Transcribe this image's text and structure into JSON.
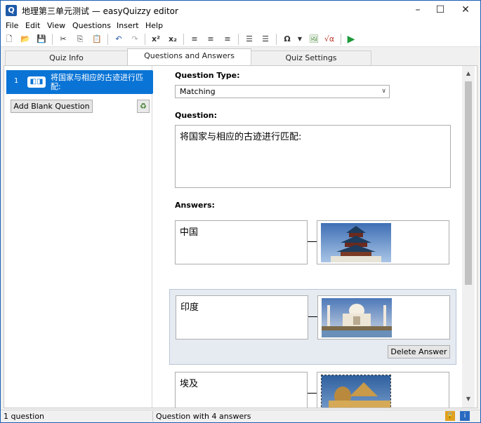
{
  "window": {
    "title": "地理第三单元测试 — easyQuizzy editor",
    "app_icon_letter": "Q",
    "minimize_icon": "minimize-icon",
    "maximize_icon": "maximize-icon",
    "close_icon": "close-icon"
  },
  "menu": [
    "File",
    "Edit",
    "View",
    "Questions",
    "Insert",
    "Help"
  ],
  "tabs": [
    {
      "label": "Quiz Info"
    },
    {
      "label": "Questions and Answers"
    },
    {
      "label": "Quiz Settings"
    }
  ],
  "sidebar": {
    "questions": [
      {
        "number": "1",
        "title": "将国家与相应的古迹进行匹配:"
      }
    ],
    "add_blank_label": "Add Blank Question"
  },
  "editor": {
    "question_type_label": "Question Type:",
    "question_type_value": "Matching",
    "question_label": "Question:",
    "question_text": "将国家与相应的古迹进行匹配:",
    "answers_label": "Answers:",
    "answers": [
      {
        "text": "中国",
        "image": "temple-of-heaven"
      },
      {
        "text": "印度",
        "image": "taj-mahal"
      },
      {
        "text": "埃及",
        "image": "sphinx"
      }
    ],
    "delete_answer_label": "Delete Answer"
  },
  "status": {
    "left": "1 question",
    "right": "Question with 4 answers"
  },
  "colors": {
    "accent": "#0a74d6",
    "highlight": "#e6ebf2"
  }
}
